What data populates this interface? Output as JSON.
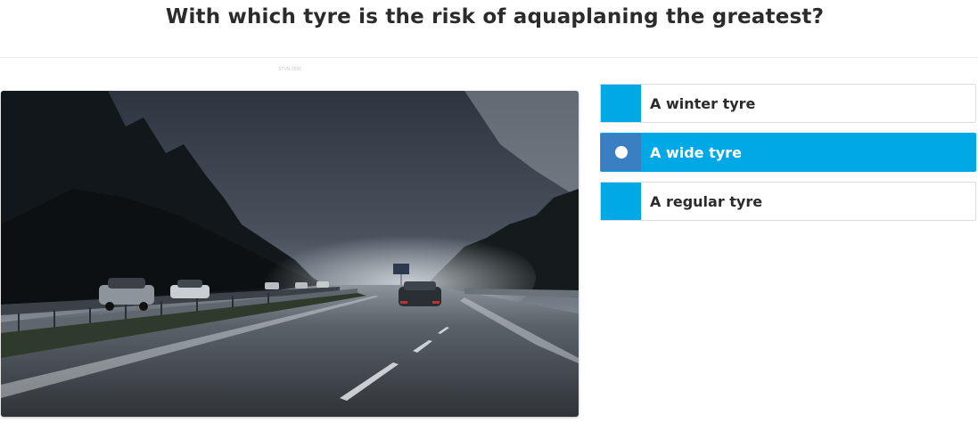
{
  "question": {
    "title": "With which tyre is the risk of aquaplaning the greatest?",
    "image_caption": "STVN 0000"
  },
  "answers": [
    {
      "label": "A winter tyre",
      "selected": false
    },
    {
      "label": "A wide tyre",
      "selected": true
    },
    {
      "label": "A regular tyre",
      "selected": false
    }
  ],
  "colors": {
    "accent": "#00a9e6",
    "selected_marker": "#3a7fc1",
    "text": "#2b2b2b"
  },
  "icons": {
    "selected_marker": "radio-dot-icon"
  }
}
